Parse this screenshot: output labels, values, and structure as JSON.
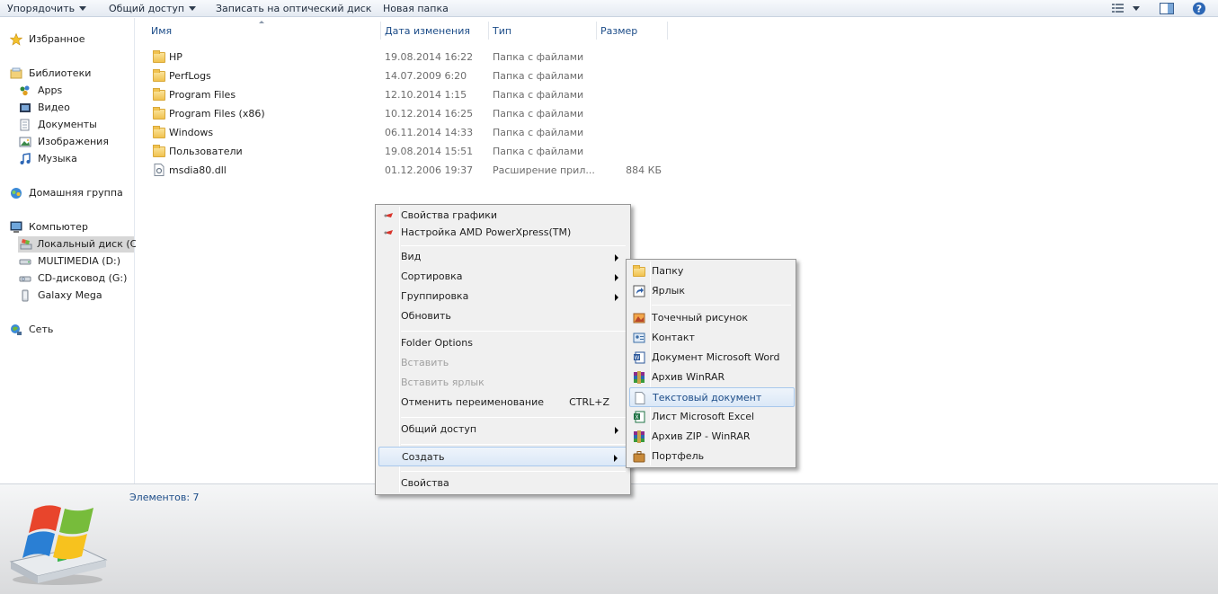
{
  "toolbar": {
    "organize": "Упорядочить",
    "share": "Общий доступ",
    "burn": "Записать на оптический диск",
    "new_folder": "Новая папка"
  },
  "nav": {
    "favorites": "Избранное",
    "libraries": "Библиотеки",
    "library_items": [
      "Apps",
      "Видео",
      "Документы",
      "Изображения",
      "Музыка"
    ],
    "homegroup": "Домашняя группа",
    "computer": "Компьютер",
    "drives": [
      "Локальный диск (C",
      "MULTIMEDIA (D:)",
      "CD-дисковод (G:)",
      "Galaxy Mega"
    ],
    "network": "Сеть"
  },
  "columns": {
    "name": "Имя",
    "date": "Дата изменения",
    "type": "Тип",
    "size": "Размер"
  },
  "files": [
    {
      "name": "HP",
      "date": "19.08.2014 16:22",
      "type": "Папка с файлами",
      "size": ""
    },
    {
      "name": "PerfLogs",
      "date": "14.07.2009 6:20",
      "type": "Папка с файлами",
      "size": ""
    },
    {
      "name": "Program Files",
      "date": "12.10.2014 1:15",
      "type": "Папка с файлами",
      "size": ""
    },
    {
      "name": "Program Files (x86)",
      "date": "10.12.2014 16:25",
      "type": "Папка с файлами",
      "size": ""
    },
    {
      "name": "Windows",
      "date": "06.11.2014 14:33",
      "type": "Папка с файлами",
      "size": ""
    },
    {
      "name": "Пользователи",
      "date": "19.08.2014 15:51",
      "type": "Папка с файлами",
      "size": ""
    },
    {
      "name": "msdia80.dll",
      "date": "01.12.2006 19:37",
      "type": "Расширение прил...",
      "size": "884 КБ"
    }
  ],
  "status": {
    "items_count": "Элементов: 7"
  },
  "context_menu": {
    "graphics_props": "Свойства графики",
    "amd": "Настройка AMD PowerXpress(TM)",
    "view": "Вид",
    "sort": "Сортировка",
    "group": "Группировка",
    "refresh": "Обновить",
    "folder_options": "Folder Options",
    "paste": "Вставить",
    "paste_shortcut": "Вставить ярлык",
    "undo_rename": "Отменить переименование",
    "undo_shortcut": "CTRL+Z",
    "share": "Общий доступ",
    "create": "Создать",
    "properties": "Свойства"
  },
  "submenu": {
    "folder": "Папку",
    "shortcut": "Ярлык",
    "bitmap": "Точечный рисунок",
    "contact": "Контакт",
    "word": "Документ Microsoft Word",
    "winrar": "Архив WinRAR",
    "text": "Текстовый документ",
    "excel": "Лист Microsoft Excel",
    "zip": "Архив ZIP - WinRAR",
    "briefcase": "Портфель"
  },
  "colors": {
    "link_blue": "#1c4c88",
    "highlight": "#dbe8f7"
  }
}
